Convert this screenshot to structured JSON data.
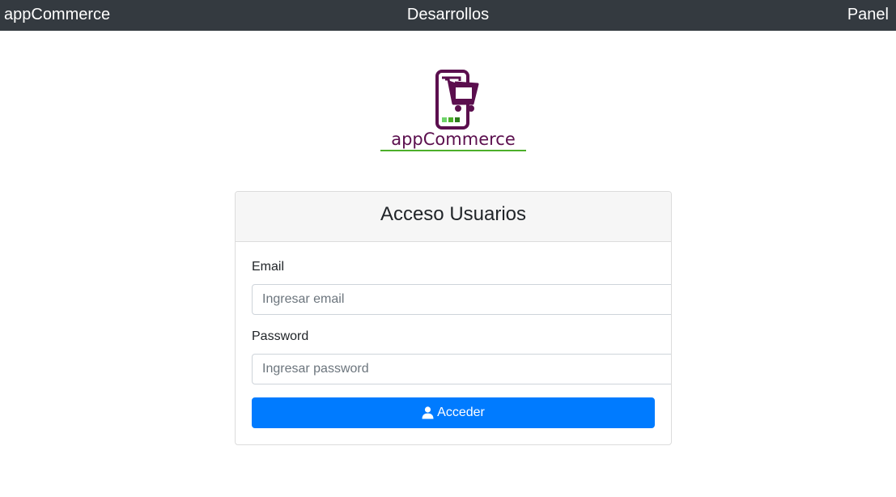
{
  "navbar": {
    "brand": "appCommerce",
    "center_link": "Desarrollos",
    "right_link": "Panel"
  },
  "logo": {
    "text": "appCommerce",
    "colors": {
      "purple": "#5b0f4e",
      "green": "#4caf2a"
    }
  },
  "login": {
    "title": "Acceso Usuarios",
    "email_label": "Email",
    "email_placeholder": "Ingresar email",
    "email_value": "",
    "password_label": "Password",
    "password_placeholder": "Ingresar password",
    "password_value": "",
    "submit_label": "Acceder",
    "submit_icon": "user-icon"
  },
  "colors": {
    "navbar_bg": "#343a40",
    "primary": "#007bff",
    "card_header_bg": "#f6f6f6"
  }
}
